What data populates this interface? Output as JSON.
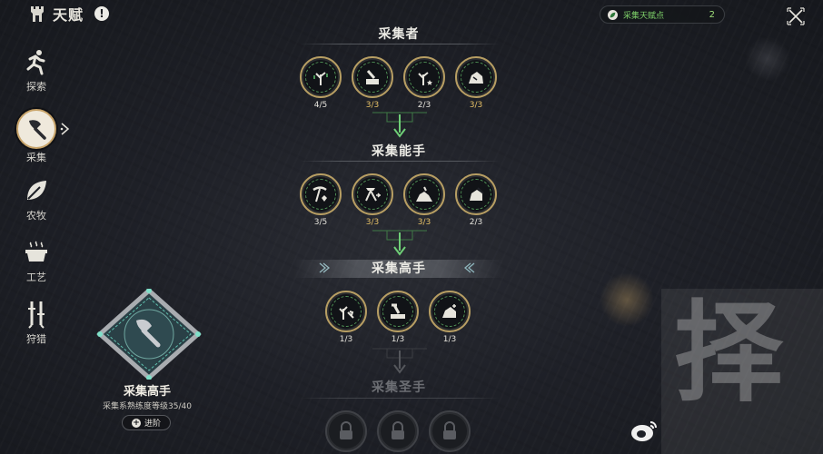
{
  "header": {
    "title": "天赋",
    "info_glyph": "!"
  },
  "points": {
    "label": "采集天赋点",
    "value": "2",
    "accent": "#7fd36a"
  },
  "sidebar": {
    "items": [
      {
        "label": "探索",
        "icon": "explore-runner-icon",
        "active": false
      },
      {
        "label": "采集",
        "icon": "axe-icon",
        "active": true
      },
      {
        "label": "农牧",
        "icon": "leaf-icon",
        "active": false
      },
      {
        "label": "工艺",
        "icon": "cooking-pot-icon",
        "active": false
      },
      {
        "label": "狩猎",
        "icon": "hunting-tools-icon",
        "active": false
      }
    ]
  },
  "emblem": {
    "title": "采集高手",
    "subtitle": "采集系熟练度等级35/40",
    "advance_label": "进阶"
  },
  "tiers": [
    {
      "name": "采集者",
      "nodes": [
        {
          "icon": "sapling-arrows-icon",
          "progress": "4/5",
          "complete": false
        },
        {
          "icon": "chopping-stump-icon",
          "progress": "3/3",
          "complete": true
        },
        {
          "icon": "sapling-star-icon",
          "progress": "2/3",
          "complete": false
        },
        {
          "icon": "ore-rock-icon",
          "progress": "3/3",
          "complete": true
        }
      ]
    },
    {
      "name": "采集能手",
      "nodes": [
        {
          "icon": "pickaxe-crystal-icon",
          "progress": "3/5",
          "complete": false
        },
        {
          "icon": "crafting-tool-icon",
          "progress": "3/3",
          "complete": true
        },
        {
          "icon": "rock-pile-icon",
          "progress": "3/3",
          "complete": true
        },
        {
          "icon": "ore-pickaxe-icon",
          "progress": "2/3",
          "complete": false
        }
      ]
    },
    {
      "name": "采集高手",
      "nodes": [
        {
          "icon": "sapling-axe-icon",
          "progress": "1/3",
          "complete": false
        },
        {
          "icon": "log-axe-icon",
          "progress": "1/3",
          "complete": false
        },
        {
          "icon": "ore-sparkle-icon",
          "progress": "1/3",
          "complete": false
        }
      ]
    },
    {
      "name": "采集圣手",
      "nodes": [
        {
          "icon": "lock-icon",
          "progress": "",
          "complete": false
        },
        {
          "icon": "lock-icon",
          "progress": "",
          "complete": false
        },
        {
          "icon": "lock-icon",
          "progress": "",
          "complete": false
        }
      ]
    }
  ],
  "watermark": {
    "char": "择"
  }
}
